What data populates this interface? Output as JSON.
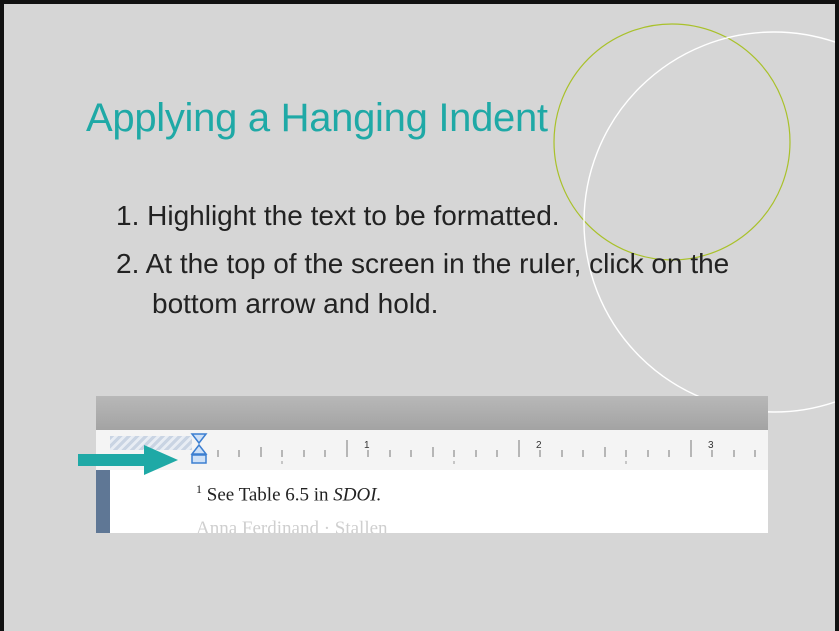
{
  "slide": {
    "title": "Applying a Hanging Indent",
    "steps": [
      "1. Highlight the text to be formatted.",
      "2. At the top of the screen in the ruler, click on the bottom arrow and hold."
    ]
  },
  "screenshot": {
    "ruler_numbers": [
      "1",
      "2",
      "3"
    ],
    "footnote_marker": "1",
    "footnote_text": "See Table 6.5 in ",
    "footnote_italic": "SDOI.",
    "faded_line": "Anna Ferdinand · Stallen"
  },
  "colors": {
    "title": "#1fa9a6",
    "arrow": "#1fa9a6",
    "slide_background": "#d6d6d6",
    "decor_circle_1": "#a9c12a",
    "decor_circle_2": "#ffffff",
    "indent_marker": "#3c7fd1"
  },
  "icons": {
    "pointer": "right-arrow-icon",
    "indent": "hanging-indent-marker-icon"
  }
}
